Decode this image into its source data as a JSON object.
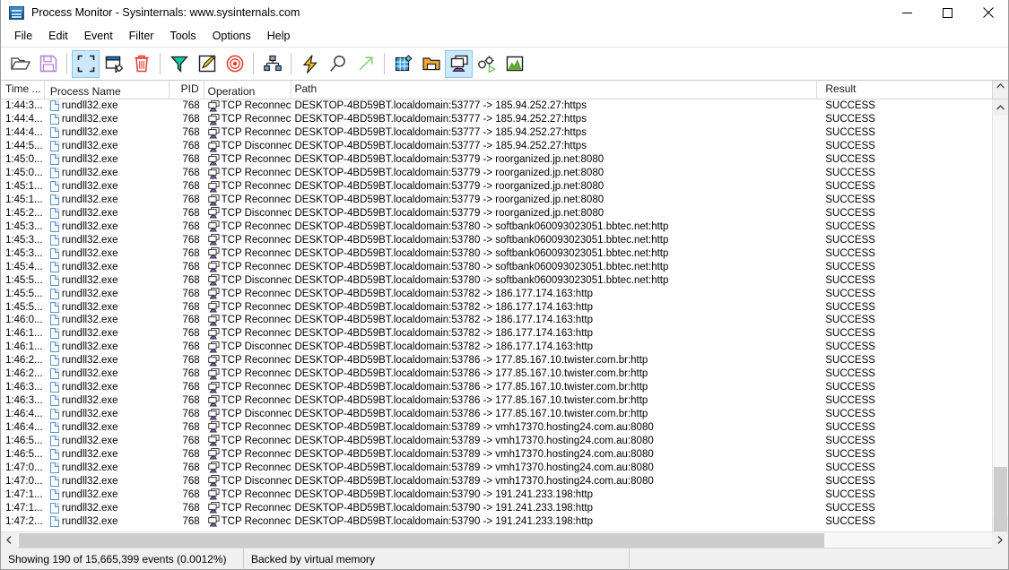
{
  "window": {
    "title": "Process Monitor - Sysinternals: www.sysinternals.com",
    "icon": "procmon-icon",
    "controls": [
      {
        "name": "minimize-button",
        "glyph": "minimize"
      },
      {
        "name": "maximize-button",
        "glyph": "maximize"
      },
      {
        "name": "close-button",
        "glyph": "close"
      }
    ]
  },
  "menubar": {
    "items": [
      {
        "label": "File"
      },
      {
        "label": "Edit"
      },
      {
        "label": "Event"
      },
      {
        "label": "Filter"
      },
      {
        "label": "Tools"
      },
      {
        "label": "Options"
      },
      {
        "label": "Help"
      }
    ]
  },
  "toolbar": {
    "buttons": [
      {
        "name": "open-icon",
        "icon": "open-folder",
        "active": false
      },
      {
        "name": "save-icon",
        "icon": "save-floppy",
        "active": false
      },
      {
        "sep": true
      },
      {
        "name": "capture-icon",
        "icon": "capture-brackets",
        "active": true
      },
      {
        "name": "autoscroll-icon",
        "icon": "autoscroll-window",
        "active": false
      },
      {
        "name": "clear-icon",
        "icon": "trash-can",
        "active": false
      },
      {
        "sep": true
      },
      {
        "name": "filter-icon",
        "icon": "funnel",
        "active": false
      },
      {
        "name": "highlight-icon",
        "icon": "pencil-square",
        "active": false
      },
      {
        "name": "include-process-icon",
        "icon": "target-crosshair",
        "active": false
      },
      {
        "sep": true
      },
      {
        "name": "process-tree-icon",
        "icon": "org-tree",
        "active": false
      },
      {
        "sep": true
      },
      {
        "name": "find-bolt-icon",
        "icon": "lightning-bolt",
        "active": false
      },
      {
        "name": "find-icon",
        "icon": "magnifier",
        "active": false
      },
      {
        "name": "jump-to-icon",
        "icon": "arrow-up-right",
        "active": false
      },
      {
        "sep": true
      },
      {
        "name": "registry-activity-icon",
        "icon": "registry-grid",
        "active": false
      },
      {
        "name": "file-activity-icon",
        "icon": "file-folder",
        "active": false
      },
      {
        "name": "network-activity-icon",
        "icon": "network-monitors",
        "active": true
      },
      {
        "name": "process-activity-icon",
        "icon": "gears-play",
        "active": false
      },
      {
        "name": "profiling-events-icon",
        "icon": "chart-mountain",
        "active": false
      }
    ]
  },
  "table": {
    "columns": [
      {
        "key": "time",
        "label": "Time ..."
      },
      {
        "key": "proc",
        "label": "Process Name"
      },
      {
        "key": "pid",
        "label": "PID"
      },
      {
        "key": "op",
        "label": "Operation"
      },
      {
        "key": "path",
        "label": "Path"
      },
      {
        "key": "result",
        "label": "Result"
      }
    ],
    "rows": [
      {
        "time": "1:44:3...",
        "proc": "rundll32.exe",
        "pid": "768",
        "op": "TCP Reconnect",
        "path": "DESKTOP-4BD59BT.localdomain:53777 -> 185.94.252.27:https",
        "result": "SUCCESS"
      },
      {
        "time": "1:44:4...",
        "proc": "rundll32.exe",
        "pid": "768",
        "op": "TCP Reconnect",
        "path": "DESKTOP-4BD59BT.localdomain:53777 -> 185.94.252.27:https",
        "result": "SUCCESS"
      },
      {
        "time": "1:44:4...",
        "proc": "rundll32.exe",
        "pid": "768",
        "op": "TCP Reconnect",
        "path": "DESKTOP-4BD59BT.localdomain:53777 -> 185.94.252.27:https",
        "result": "SUCCESS"
      },
      {
        "time": "1:44:5...",
        "proc": "rundll32.exe",
        "pid": "768",
        "op": "TCP Disconnect",
        "path": "DESKTOP-4BD59BT.localdomain:53777 -> 185.94.252.27:https",
        "result": "SUCCESS"
      },
      {
        "time": "1:45:0...",
        "proc": "rundll32.exe",
        "pid": "768",
        "op": "TCP Reconnect",
        "path": "DESKTOP-4BD59BT.localdomain:53779 -> roorganized.jp.net:8080",
        "result": "SUCCESS"
      },
      {
        "time": "1:45:0...",
        "proc": "rundll32.exe",
        "pid": "768",
        "op": "TCP Reconnect",
        "path": "DESKTOP-4BD59BT.localdomain:53779 -> roorganized.jp.net:8080",
        "result": "SUCCESS"
      },
      {
        "time": "1:45:1...",
        "proc": "rundll32.exe",
        "pid": "768",
        "op": "TCP Reconnect",
        "path": "DESKTOP-4BD59BT.localdomain:53779 -> roorganized.jp.net:8080",
        "result": "SUCCESS"
      },
      {
        "time": "1:45:1...",
        "proc": "rundll32.exe",
        "pid": "768",
        "op": "TCP Reconnect",
        "path": "DESKTOP-4BD59BT.localdomain:53779 -> roorganized.jp.net:8080",
        "result": "SUCCESS"
      },
      {
        "time": "1:45:2...",
        "proc": "rundll32.exe",
        "pid": "768",
        "op": "TCP Disconnect",
        "path": "DESKTOP-4BD59BT.localdomain:53779 -> roorganized.jp.net:8080",
        "result": "SUCCESS"
      },
      {
        "time": "1:45:3...",
        "proc": "rundll32.exe",
        "pid": "768",
        "op": "TCP Reconnect",
        "path": "DESKTOP-4BD59BT.localdomain:53780 -> softbank060093023051.bbtec.net:http",
        "result": "SUCCESS"
      },
      {
        "time": "1:45:3...",
        "proc": "rundll32.exe",
        "pid": "768",
        "op": "TCP Reconnect",
        "path": "DESKTOP-4BD59BT.localdomain:53780 -> softbank060093023051.bbtec.net:http",
        "result": "SUCCESS"
      },
      {
        "time": "1:45:3...",
        "proc": "rundll32.exe",
        "pid": "768",
        "op": "TCP Reconnect",
        "path": "DESKTOP-4BD59BT.localdomain:53780 -> softbank060093023051.bbtec.net:http",
        "result": "SUCCESS"
      },
      {
        "time": "1:45:4...",
        "proc": "rundll32.exe",
        "pid": "768",
        "op": "TCP Reconnect",
        "path": "DESKTOP-4BD59BT.localdomain:53780 -> softbank060093023051.bbtec.net:http",
        "result": "SUCCESS"
      },
      {
        "time": "1:45:5...",
        "proc": "rundll32.exe",
        "pid": "768",
        "op": "TCP Disconnect",
        "path": "DESKTOP-4BD59BT.localdomain:53780 -> softbank060093023051.bbtec.net:http",
        "result": "SUCCESS"
      },
      {
        "time": "1:45:5...",
        "proc": "rundll32.exe",
        "pid": "768",
        "op": "TCP Reconnect",
        "path": "DESKTOP-4BD59BT.localdomain:53782 -> 186.177.174.163:http",
        "result": "SUCCESS"
      },
      {
        "time": "1:45:5...",
        "proc": "rundll32.exe",
        "pid": "768",
        "op": "TCP Reconnect",
        "path": "DESKTOP-4BD59BT.localdomain:53782 -> 186.177.174.163:http",
        "result": "SUCCESS"
      },
      {
        "time": "1:46:0...",
        "proc": "rundll32.exe",
        "pid": "768",
        "op": "TCP Reconnect",
        "path": "DESKTOP-4BD59BT.localdomain:53782 -> 186.177.174.163:http",
        "result": "SUCCESS"
      },
      {
        "time": "1:46:1...",
        "proc": "rundll32.exe",
        "pid": "768",
        "op": "TCP Reconnect",
        "path": "DESKTOP-4BD59BT.localdomain:53782 -> 186.177.174.163:http",
        "result": "SUCCESS"
      },
      {
        "time": "1:46:1...",
        "proc": "rundll32.exe",
        "pid": "768",
        "op": "TCP Disconnect",
        "path": "DESKTOP-4BD59BT.localdomain:53782 -> 186.177.174.163:http",
        "result": "SUCCESS"
      },
      {
        "time": "1:46:2...",
        "proc": "rundll32.exe",
        "pid": "768",
        "op": "TCP Reconnect",
        "path": "DESKTOP-4BD59BT.localdomain:53786 -> 177.85.167.10.twister.com.br:http",
        "result": "SUCCESS"
      },
      {
        "time": "1:46:2...",
        "proc": "rundll32.exe",
        "pid": "768",
        "op": "TCP Reconnect",
        "path": "DESKTOP-4BD59BT.localdomain:53786 -> 177.85.167.10.twister.com.br:http",
        "result": "SUCCESS"
      },
      {
        "time": "1:46:3...",
        "proc": "rundll32.exe",
        "pid": "768",
        "op": "TCP Reconnect",
        "path": "DESKTOP-4BD59BT.localdomain:53786 -> 177.85.167.10.twister.com.br:http",
        "result": "SUCCESS"
      },
      {
        "time": "1:46:3...",
        "proc": "rundll32.exe",
        "pid": "768",
        "op": "TCP Reconnect",
        "path": "DESKTOP-4BD59BT.localdomain:53786 -> 177.85.167.10.twister.com.br:http",
        "result": "SUCCESS"
      },
      {
        "time": "1:46:4...",
        "proc": "rundll32.exe",
        "pid": "768",
        "op": "TCP Disconnect",
        "path": "DESKTOP-4BD59BT.localdomain:53786 -> 177.85.167.10.twister.com.br:http",
        "result": "SUCCESS"
      },
      {
        "time": "1:46:4...",
        "proc": "rundll32.exe",
        "pid": "768",
        "op": "TCP Reconnect",
        "path": "DESKTOP-4BD59BT.localdomain:53789 -> vmh17370.hosting24.com.au:8080",
        "result": "SUCCESS"
      },
      {
        "time": "1:46:5...",
        "proc": "rundll32.exe",
        "pid": "768",
        "op": "TCP Reconnect",
        "path": "DESKTOP-4BD59BT.localdomain:53789 -> vmh17370.hosting24.com.au:8080",
        "result": "SUCCESS"
      },
      {
        "time": "1:46:5...",
        "proc": "rundll32.exe",
        "pid": "768",
        "op": "TCP Reconnect",
        "path": "DESKTOP-4BD59BT.localdomain:53789 -> vmh17370.hosting24.com.au:8080",
        "result": "SUCCESS"
      },
      {
        "time": "1:47:0...",
        "proc": "rundll32.exe",
        "pid": "768",
        "op": "TCP Reconnect",
        "path": "DESKTOP-4BD59BT.localdomain:53789 -> vmh17370.hosting24.com.au:8080",
        "result": "SUCCESS"
      },
      {
        "time": "1:47:0...",
        "proc": "rundll32.exe",
        "pid": "768",
        "op": "TCP Disconnect",
        "path": "DESKTOP-4BD59BT.localdomain:53789 -> vmh17370.hosting24.com.au:8080",
        "result": "SUCCESS"
      },
      {
        "time": "1:47:1...",
        "proc": "rundll32.exe",
        "pid": "768",
        "op": "TCP Reconnect",
        "path": "DESKTOP-4BD59BT.localdomain:53790 -> 191.241.233.198:http",
        "result": "SUCCESS"
      },
      {
        "time": "1:47:1...",
        "proc": "rundll32.exe",
        "pid": "768",
        "op": "TCP Reconnect",
        "path": "DESKTOP-4BD59BT.localdomain:53790 -> 191.241.233.198:http",
        "result": "SUCCESS"
      },
      {
        "time": "1:47:2...",
        "proc": "rundll32.exe",
        "pid": "768",
        "op": "TCP Reconnect",
        "path": "DESKTOP-4BD59BT.localdomain:53790 -> 191.241.233.198:http",
        "result": "SUCCESS"
      }
    ]
  },
  "statusbar": {
    "events_text": "Showing 190 of 15,665,399 events (0.0012%)",
    "backing_text": "Backed by virtual memory",
    "third_text": ""
  },
  "colors": {
    "accent": "#0078d7",
    "toolbar_active": "#cce8ff",
    "scroll_thumb": "#cdcdcd",
    "status_bg": "#f0f0f0"
  }
}
